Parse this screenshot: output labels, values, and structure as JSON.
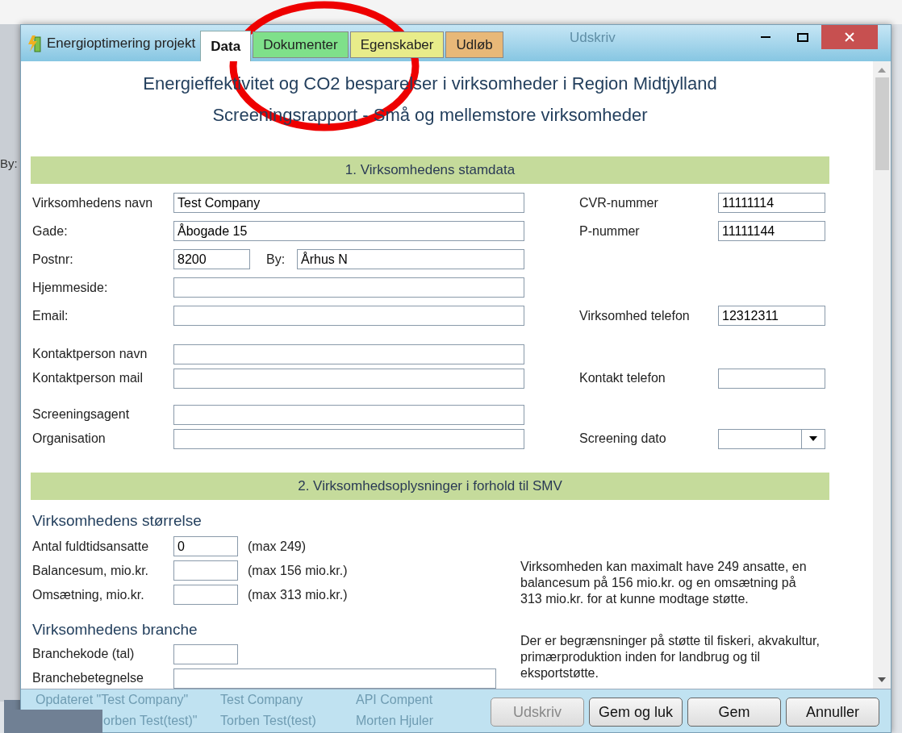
{
  "background": {
    "toolbar_button": "Udskriv",
    "side_label": "By:",
    "ghost_rows": [
      [
        "Opdateret \"Test Company\"",
        "Test Company",
        "API Compent"
      ],
      [
        "orben Test(test)\"",
        "Torben Test(test)",
        "Morten Hjuler"
      ]
    ]
  },
  "window": {
    "title": "Energioptimering projekt"
  },
  "tabs": [
    {
      "label": "Data",
      "selected": true,
      "color": "#ffffff"
    },
    {
      "label": "Dokumenter",
      "selected": false,
      "color": "#7fe08a"
    },
    {
      "label": "Egenskaber",
      "selected": false,
      "color": "#e8ec8a"
    },
    {
      "label": "Udløb",
      "selected": false,
      "color": "#e8b878"
    }
  ],
  "heading": [
    "Energieffektivitet og CO2 besparelser i virksomheder i Region Midtjylland",
    "Screeningsrapport - Små og mellemstore virksomheder"
  ],
  "section1": {
    "title": "1. Virksomhedens stamdata",
    "groups": [
      [
        {
          "left": {
            "label": "Virksomhedens navn",
            "value": "Test Company"
          },
          "right": {
            "label": "CVR-nummer",
            "value": "11111114",
            "kind": "text"
          }
        },
        {
          "left": {
            "label": "Gade:",
            "value": "Åbogade 15"
          },
          "right": {
            "label": "P-nummer",
            "value": "11111144",
            "kind": "text"
          }
        },
        {
          "left": {
            "label": "Postnr:",
            "value": "8200",
            "city_label": "By:",
            "city": "Århus N"
          }
        },
        {
          "left": {
            "label": "Hjemmeside:"
          }
        },
        {
          "left": {
            "label": "Email:"
          },
          "right": {
            "label": "Virksomhed telefon",
            "value": "12312311",
            "kind": "text"
          }
        }
      ],
      [
        {
          "left": {
            "label": "Kontaktperson navn"
          }
        },
        {
          "left": {
            "label": "Kontaktperson mail"
          },
          "right": {
            "label": "Kontakt telefon",
            "kind": "text"
          }
        }
      ],
      [
        {
          "left": {
            "label": "Screeningsagent"
          }
        },
        {
          "left": {
            "label": "Organisation"
          },
          "right": {
            "label": "Screening dato",
            "kind": "date"
          }
        }
      ]
    ]
  },
  "section2": {
    "title": "2. Virksomhedsoplysninger i forhold til SMV",
    "size": {
      "title": "Virksomhedens størrelse",
      "rows": [
        {
          "label": "Antal fuldtidsansatte",
          "value": "0",
          "hint": "(max 249)"
        },
        {
          "label": "Balancesum, mio.kr.",
          "hint": "(max 156 mio.kr.)"
        },
        {
          "label": "Omsætning, mio.kr.",
          "hint": "(max 313 mio.kr.)"
        }
      ],
      "note": "Virksomheden kan maximalt have 249 ansatte, en balancesum på 156 mio.kr. og en omsætning på 313 mio.kr. for at kunne modtage støtte."
    },
    "branch": {
      "title": "Virksomhedens branche",
      "rows": [
        {
          "label": "Branchekode (tal)",
          "kind": "short"
        },
        {
          "label": "Branchebetegnelse",
          "kind": "wide"
        }
      ],
      "note": "Der er begrænsninger på støtte til fiskeri, akvakultur, primærproduktion inden for landbrug og til eksportstøtte."
    }
  },
  "buttons": [
    {
      "label": "Udskriv",
      "disabled": true
    },
    {
      "label": "Gem og luk",
      "disabled": false
    },
    {
      "label": "Gem",
      "disabled": false
    },
    {
      "label": "Annuller",
      "disabled": false
    }
  ]
}
